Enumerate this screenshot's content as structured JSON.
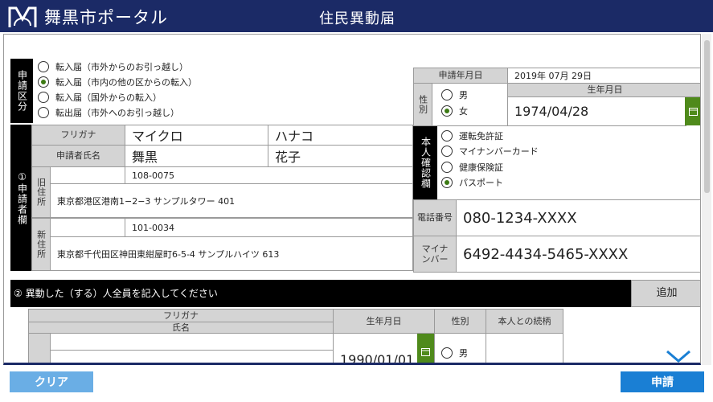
{
  "header": {
    "app_name": "舞黒市ポータル",
    "title": "住民異動届"
  },
  "application_type": {
    "label": "申請区分",
    "options": [
      {
        "label": "転入届（市外からのお引っ越し）",
        "selected": false
      },
      {
        "label": "転入届（市内の他の区からの転入）",
        "selected": true
      },
      {
        "label": "転入届（国外からの転入）",
        "selected": false
      },
      {
        "label": "転出届（市外へのお引っ越し）",
        "selected": false
      }
    ]
  },
  "application_date": {
    "label": "申請年月日",
    "value": "2019年 07月 29日"
  },
  "gender": {
    "label": "性別",
    "options": [
      {
        "label": "男",
        "selected": false
      },
      {
        "label": "女",
        "selected": true
      }
    ]
  },
  "birth_date": {
    "label": "生年月日",
    "value": "1974/04/28"
  },
  "applicant": {
    "section_label": "①申請者欄",
    "furigana_label": "フリガナ",
    "furigana_last": "マイクロ",
    "furigana_first": "ハナコ",
    "name_label": "申請者氏名",
    "name_last": "舞黒",
    "name_first": "花子",
    "old_address_label": "旧住所",
    "old_postal": "108-0075",
    "old_address": "東京都港区港南1−2−3 サンプルタワー 401",
    "new_address_label": "新住所",
    "new_postal": "101-0034",
    "new_address": "東京都千代田区神田東紺屋町6-5-4 サンプルハイツ 613"
  },
  "identity": {
    "label": "本人確認欄",
    "options": [
      {
        "label": "運転免許証",
        "selected": false
      },
      {
        "label": "マイナンバーカード",
        "selected": false
      },
      {
        "label": "健康保険証",
        "selected": false
      },
      {
        "label": "パスポート",
        "selected": true
      }
    ]
  },
  "phone": {
    "label": "電話番号",
    "value": "080-1234-XXXX"
  },
  "my_number": {
    "label": "マイナンバー",
    "value": "6492-4434-5465-XXXX"
  },
  "movers": {
    "section_label": "② 異動した（する）人全員を記入してください",
    "add_label": "追加",
    "headers": {
      "furigana": "フリガナ",
      "name": "氏名",
      "birth": "生年月日",
      "gender": "性別",
      "relation": "本人との続柄"
    },
    "rows": [
      {
        "birth": "1990/01/01",
        "gender_option": "男"
      }
    ]
  },
  "footer": {
    "clear_label": "クリア",
    "submit_label": "申請"
  },
  "colors": {
    "header": "#1b2a66",
    "accent_green": "#4f8a1b",
    "button_blue": "#1a7fd4",
    "clear_blue": "#6aaee5"
  }
}
